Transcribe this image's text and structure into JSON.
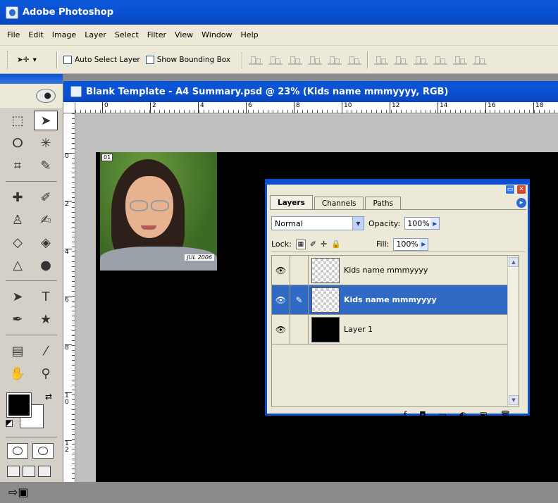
{
  "app": {
    "title": "Adobe Photoshop"
  },
  "menu": [
    "File",
    "Edit",
    "Image",
    "Layer",
    "Select",
    "Filter",
    "View",
    "Window",
    "Help"
  ],
  "options": {
    "auto_select_label": "Auto Select Layer",
    "show_bbox_label": "Show Bounding Box"
  },
  "document": {
    "title": "Blank Template - A4 Summary.psd @ 23% (Kids name mmmyyyy, RGB)",
    "hruler": [
      "0",
      "2",
      "4",
      "6",
      "8",
      "10",
      "12",
      "14",
      "16",
      "18"
    ],
    "vruler": [
      "0",
      "2",
      "4",
      "6",
      "8",
      "1\n0",
      "1\n2"
    ]
  },
  "photo": {
    "badge": "01",
    "date": "JUL 2006"
  },
  "layers_panel": {
    "tabs": [
      "Layers",
      "Channels",
      "Paths"
    ],
    "blend_mode": "Normal",
    "opacity_label": "Opacity:",
    "opacity_value": "100%",
    "lock_label": "Lock:",
    "fill_label": "Fill:",
    "fill_value": "100%",
    "layers": [
      {
        "name": "Kids name mmmyyyy"
      },
      {
        "name": "Kids name mmmyyyy"
      },
      {
        "name": "Layer 1"
      }
    ]
  },
  "colors": {
    "title_bar": "#0a4fd0",
    "selection": "#316ac5",
    "foreground": "#000000",
    "background": "#ffffff"
  }
}
